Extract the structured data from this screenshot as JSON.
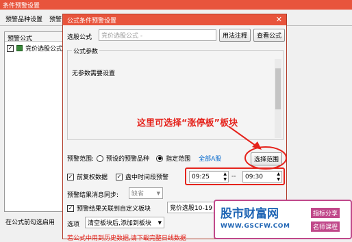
{
  "outer": {
    "title": "条件预警设置",
    "tabs": [
      "预警品种设置",
      "预警"
    ],
    "list_header": "预警公式",
    "list_item": "竞价选股公式",
    "bottom_label": "在公式前勾选启用"
  },
  "dialog": {
    "title": "公式条件预警设置",
    "close_glyph": "✕",
    "formula_label": "选股公式",
    "formula_value": "竞价选股公式 -",
    "usage_button": "用法注释",
    "view_button": "查看公式",
    "params_group": "公式参数",
    "params_text": "无参数需要设置",
    "annotation": "这里可选择“涨停板”板块",
    "range_label": "预警范围:",
    "range_opt1": "预设的预警品种",
    "range_opt2": "指定范围",
    "range_link": "全部A股",
    "select_range_button": "选择范围",
    "adjust_label": "前复权数据",
    "intraday_label": "盘中时间段预警",
    "time_start": "09:25",
    "time_sep": "--",
    "time_end": "09:30",
    "sync_label": "预警结果消息同步:",
    "sync_value": "缺省",
    "link_label": "预警结果关联到自定义板块",
    "link_value": "竞价选股10-19",
    "options_label": "选项",
    "options_value": "清空板块后,添加到板块",
    "warning_text": "若公式中用到历史数据,请下载完整日线数据",
    "bottom_partial": "财富"
  },
  "watermark": {
    "brand": "股市财富网",
    "url": "WWW.GSCFW.COM",
    "tag1": "指标分享",
    "tag2": "名师课程"
  },
  "colors": {
    "title_bar": "#e8543c",
    "annotation": "#e5231c",
    "highlight_circle": "#e5231c",
    "link": "#0066cc",
    "watermark_brand": "#1e64b4"
  }
}
